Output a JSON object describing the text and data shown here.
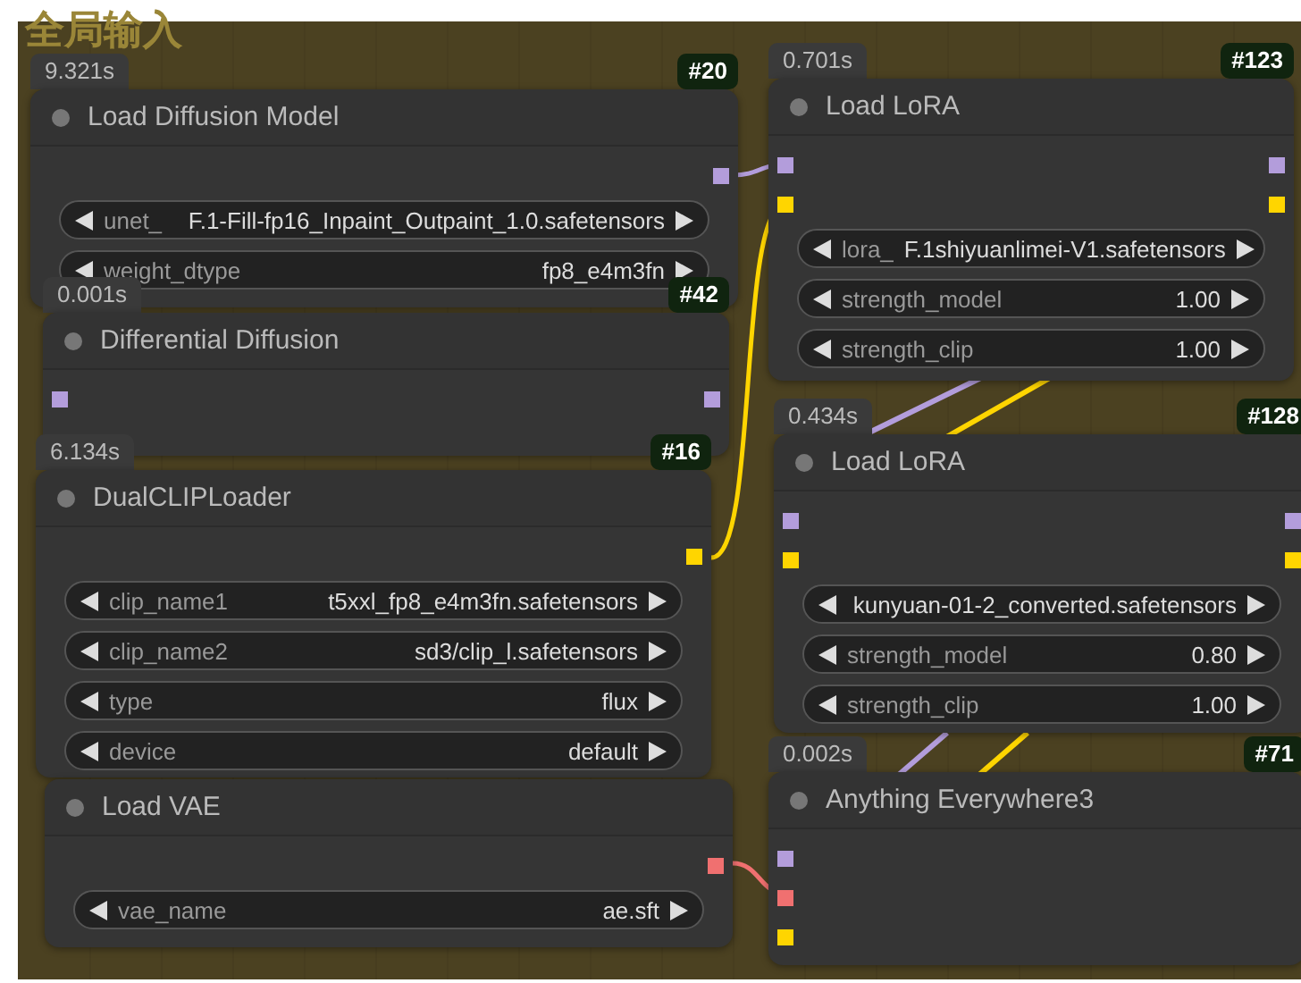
{
  "group_title": "全局输入",
  "nodes": [
    {
      "time": "9.321s",
      "id": "#20",
      "title": "Load Diffusion Model",
      "outputs": [
        {
          "color": "#b39ddb"
        }
      ],
      "widgets": [
        {
          "label": "unet_",
          "value": "F.1-Fill-fp16_Inpaint_Outpaint_1.0.safetensors"
        },
        {
          "label": "weight_dtype",
          "value": "fp8_e4m3fn"
        }
      ]
    },
    {
      "time": "0.001s",
      "id": "#42",
      "title": "Differential Diffusion",
      "inputs": [
        {
          "color": "#b39ddb"
        }
      ],
      "outputs": [
        {
          "color": "#b39ddb"
        }
      ]
    },
    {
      "time": "6.134s",
      "id": "#16",
      "title": "DualCLIPLoader",
      "outputs": [
        {
          "color": "#ffd500"
        }
      ],
      "widgets": [
        {
          "label": "clip_name1",
          "value": "t5xxl_fp8_e4m3fn.safetensors"
        },
        {
          "label": "clip_name2",
          "value": "sd3/clip_l.safetensors"
        },
        {
          "label": "type",
          "value": "flux"
        },
        {
          "label": "device",
          "value": "default"
        }
      ]
    },
    {
      "title": "Load VAE",
      "outputs": [
        {
          "color": "#f07070"
        }
      ],
      "widgets": [
        {
          "label": "vae_name",
          "value": "ae.sft"
        }
      ]
    },
    {
      "time": "0.701s",
      "id": "#123",
      "title": "Load LoRA",
      "inputs": [
        {
          "color": "#b39ddb"
        },
        {
          "color": "#ffd500"
        }
      ],
      "outputs": [
        {
          "color": "#b39ddb"
        },
        {
          "color": "#ffd500"
        }
      ],
      "widgets": [
        {
          "label": "lora_",
          "value": "F.1shiyuanlimei-V1.safetensors"
        },
        {
          "label": "strength_model",
          "value": "1.00"
        },
        {
          "label": "strength_clip",
          "value": "1.00"
        }
      ]
    },
    {
      "time": "0.434s",
      "id": "#128",
      "title": "Load LoRA",
      "inputs": [
        {
          "color": "#b39ddb"
        },
        {
          "color": "#ffd500"
        }
      ],
      "outputs": [
        {
          "color": "#b39ddb"
        },
        {
          "color": "#ffd500"
        }
      ],
      "widgets": [
        {
          "value": "kunyuan-01-2_converted.safetensors"
        },
        {
          "label": "strength_model",
          "value": "0.80"
        },
        {
          "label": "strength_clip",
          "value": "1.00"
        }
      ]
    },
    {
      "time": "0.002s",
      "id": "#71",
      "title": "Anything Everywhere3",
      "inputs": [
        {
          "color": "#b39ddb"
        },
        {
          "color": "#f07070"
        },
        {
          "color": "#ffd500"
        }
      ]
    }
  ]
}
